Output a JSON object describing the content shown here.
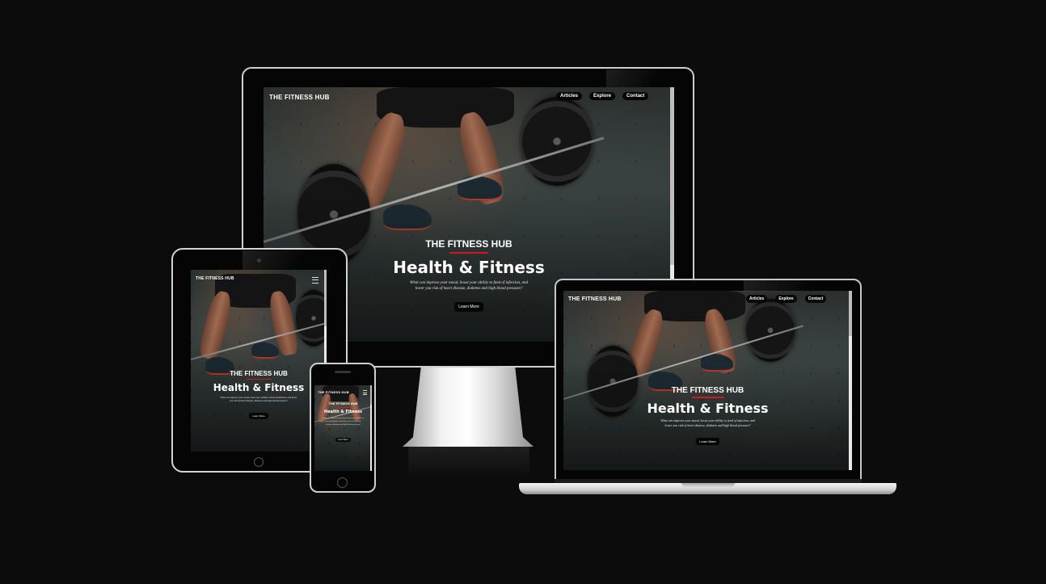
{
  "site": {
    "brand": "THE FITNESS HUB",
    "nav": [
      "Articles",
      "Explore",
      "Contact"
    ],
    "hero": {
      "brand": "THE FITNESS HUB",
      "title": "Health & Fitness",
      "text": "What can improve your mood, boost your ability to fend of infection, and lower you risk of heart disease, diabetes and high blood pressure?",
      "button": "Learn More"
    }
  },
  "colors": {
    "accent": "#c81d1d",
    "background": "#0d0c0d",
    "nav_pill": "#050505"
  },
  "icons": {
    "menu": "hamburger-icon"
  }
}
